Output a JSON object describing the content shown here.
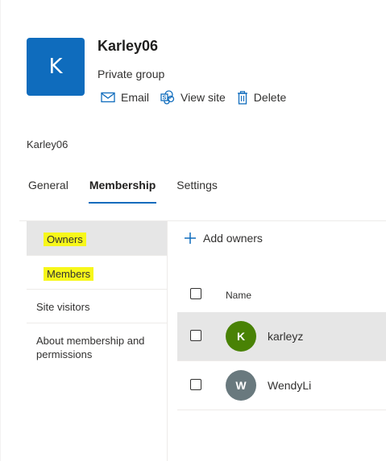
{
  "group": {
    "avatar_letter": "K",
    "name": "Karley06",
    "privacy": "Private group",
    "actions": [
      {
        "label": "Email",
        "icon": "mail-icon"
      },
      {
        "label": "View site",
        "icon": "sharepoint-icon"
      },
      {
        "label": "Delete",
        "icon": "trash-icon"
      }
    ]
  },
  "breadcrumb": "Karley06",
  "tabs": [
    {
      "label": "General",
      "active": false
    },
    {
      "label": "Membership",
      "active": true
    },
    {
      "label": "Settings",
      "active": false
    }
  ],
  "sidenav": {
    "items": [
      {
        "label": "Owners",
        "selected": true,
        "highlighted": true
      },
      {
        "label": "Members",
        "selected": false,
        "highlighted": true
      },
      {
        "label": "Site visitors",
        "selected": false,
        "highlighted": false
      },
      {
        "label": "About membership and permissions",
        "selected": false,
        "highlighted": false
      }
    ]
  },
  "owners": {
    "add_label": "Add owners",
    "column_name": "Name",
    "rows": [
      {
        "initial": "K",
        "name": "karleyz",
        "avatar_color": "#498205",
        "highlighted": true
      },
      {
        "initial": "W",
        "name": "WendyLi",
        "avatar_color": "#69797e",
        "highlighted": false
      }
    ]
  },
  "colors": {
    "accent": "#0f6cbd",
    "highlighter": "#f7f71a"
  }
}
